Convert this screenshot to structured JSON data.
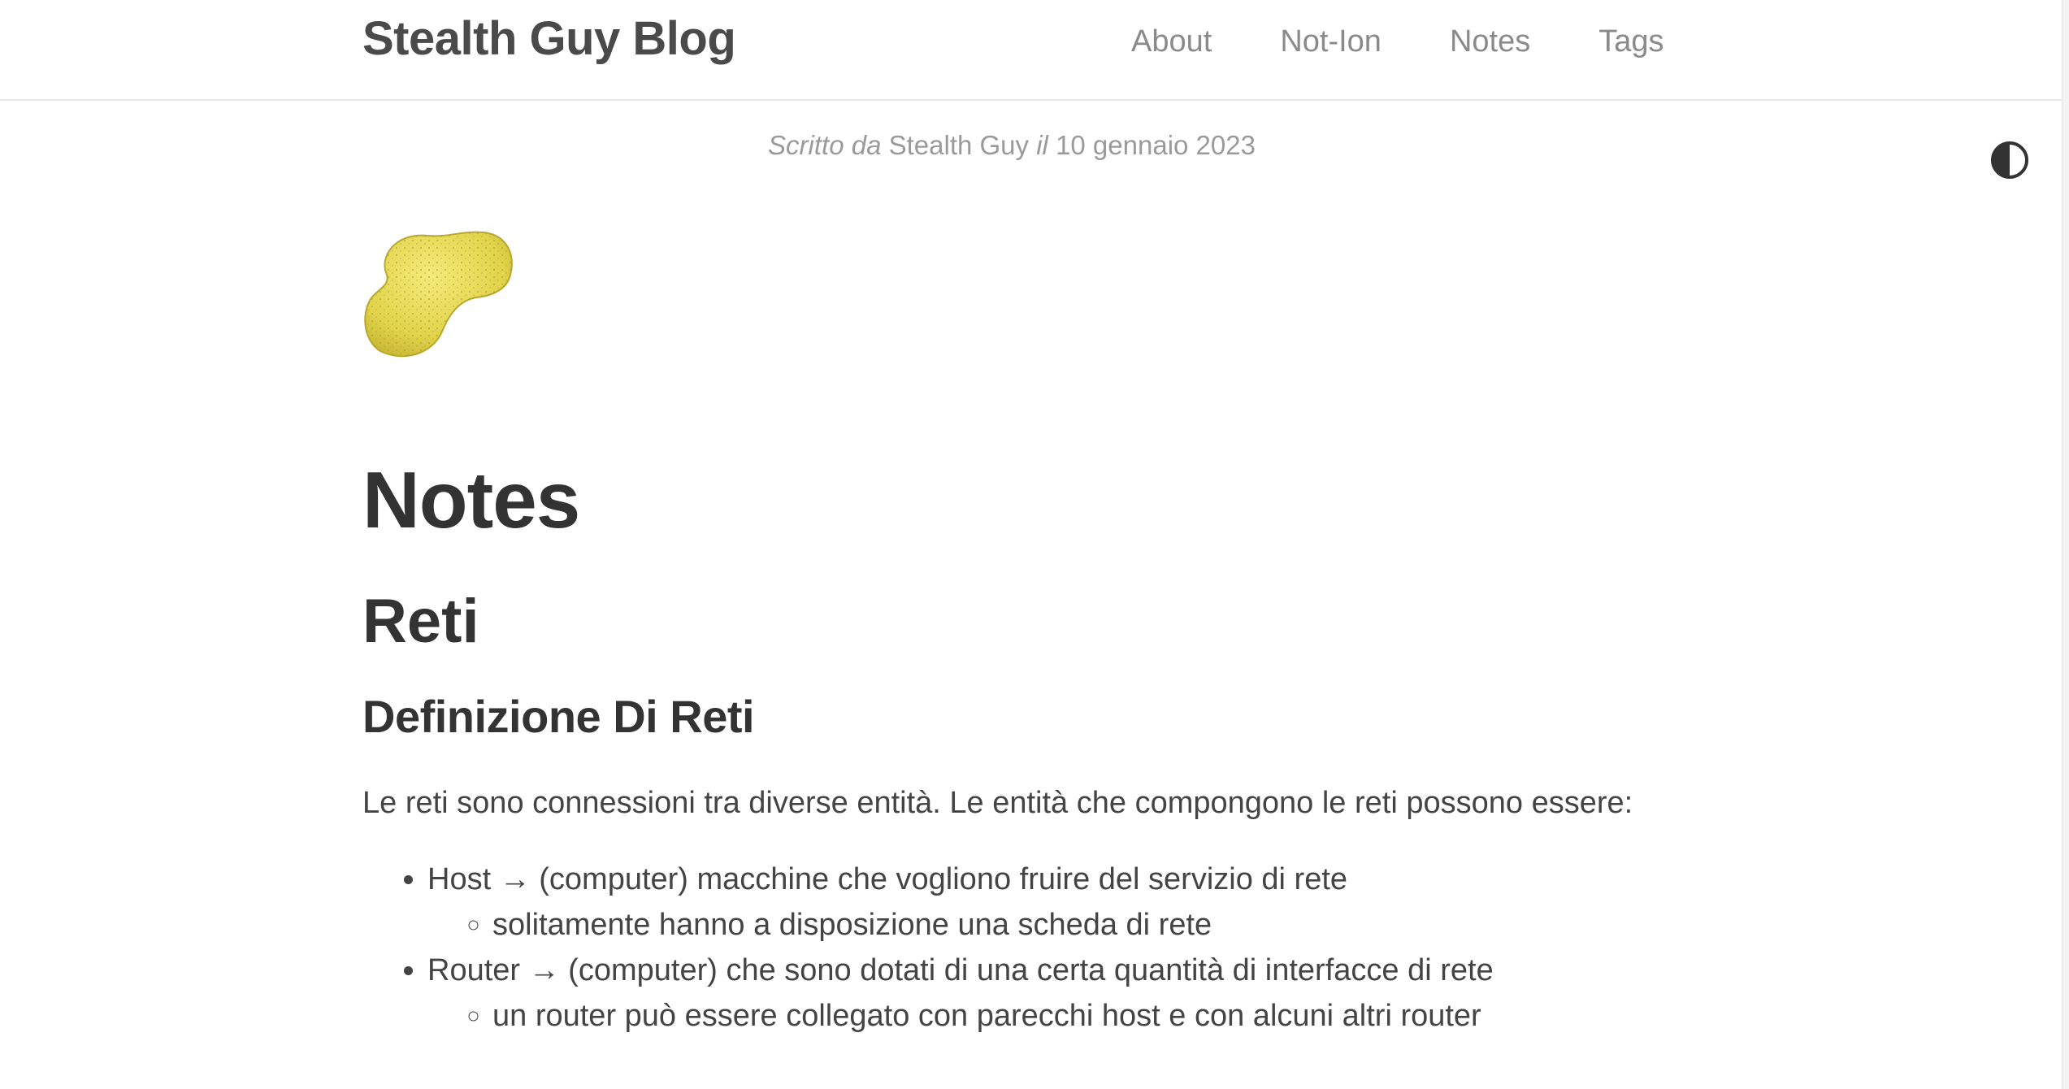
{
  "header": {
    "site_title": "Stealth Guy Blog",
    "nav": [
      "About",
      "Not-Ion",
      "Notes",
      "Tags"
    ]
  },
  "theme_toggle_icon": "half-circle-contrast-icon",
  "byline": {
    "written_by": "Scritto da",
    "author": "Stealth Guy",
    "on": "il",
    "date": "10 gennaio 2023"
  },
  "hero_icon": "sponge-emoji",
  "article": {
    "title": "Notes",
    "section": "Reti",
    "subsection": "Definizione Di Reti",
    "intro": "Le reti sono connessioni tra diverse entità. Le entità che compongono le reti possono essere:",
    "items": [
      {
        "text": "Host → (computer) macchine che vogliono fruire del servizio di rete",
        "sub": "solitamente hanno a disposizione una scheda di rete"
      },
      {
        "text": "Router → (computer) che sono dotati di una certa quantità di interfacce di rete",
        "sub": "un router può essere collegato con parecchi host e con alcuni altri router"
      }
    ]
  },
  "colors": {
    "title": "#4a4a4a",
    "nav": "#8a8a8a",
    "text": "#333333",
    "muted": "#9a9a9a",
    "sponge": "#e6d94e"
  }
}
